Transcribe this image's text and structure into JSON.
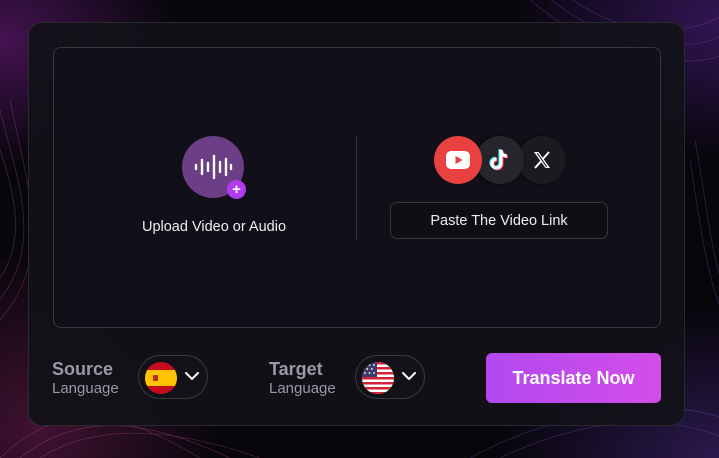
{
  "upload": {
    "label": "Upload Video or Audio",
    "icon": "audio-wave-icon",
    "badge_icon": "plus-icon",
    "badge_glyph": "+"
  },
  "link": {
    "platform_icons": [
      "youtube-icon",
      "tiktok-icon",
      "x-icon"
    ],
    "paste_label": "Paste The Video Link"
  },
  "source": {
    "title": "Source",
    "subtitle": "Language",
    "flag_icon": "spain-flag-icon"
  },
  "target": {
    "title": "Target",
    "subtitle": "Language",
    "flag_icon": "usa-flag-icon"
  },
  "translate_label": "Translate Now",
  "colors": {
    "accent": "#c04bee",
    "youtube": "#e8413f",
    "upload_circle": "#6b3e86"
  }
}
